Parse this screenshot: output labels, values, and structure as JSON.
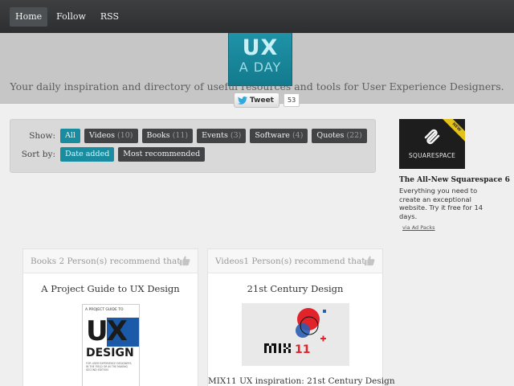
{
  "nav": {
    "home": "Home",
    "follow": "Follow",
    "rss": "RSS"
  },
  "logo": {
    "line1": "UX",
    "line2": "A DAY"
  },
  "tweet": {
    "label": "Tweet",
    "count": "53"
  },
  "tagline": "Your daily inspiration and directory of useful resources and tools for User Experience Designers.",
  "filters": {
    "show_label": "Show:",
    "sort_label": "Sort by:",
    "show": [
      {
        "name": "All",
        "count": ""
      },
      {
        "name": "Videos",
        "count": "(10)"
      },
      {
        "name": "Books",
        "count": "(11)"
      },
      {
        "name": "Events",
        "count": "(3)"
      },
      {
        "name": "Software",
        "count": "(4)"
      },
      {
        "name": "Quotes",
        "count": "(22)"
      }
    ],
    "sort": [
      "Date added",
      "Most recommended"
    ]
  },
  "ad": {
    "badge": "NEW",
    "brand": "SQUARESPACE",
    "title": "The All-New Squarespace 6",
    "text": "Everything you need to create an exceptional website. Try it free for 14 days.",
    "via": "via Ad Packs"
  },
  "cards": [
    {
      "header": "Books 2 Person(s) recommend that",
      "title": "A Project Guide to UX Design",
      "cover": {
        "top": "A PROJECT GUIDE TO",
        "big": "UX",
        "design": "DESIGN",
        "small": "FOR USER EXPERIENCE DESIGNERS IN THE FIELD OR IN THE MAKING SECOND EDITION"
      }
    },
    {
      "header": "Videos1 Person(s) recommend that",
      "title": "21st Century Design",
      "caption": "MIX11 UX inspiration: 21st Century Design"
    }
  ],
  "colors": {
    "accent": "#1a8ca0",
    "chip": "#414345",
    "topbar": "#2c2e30"
  }
}
